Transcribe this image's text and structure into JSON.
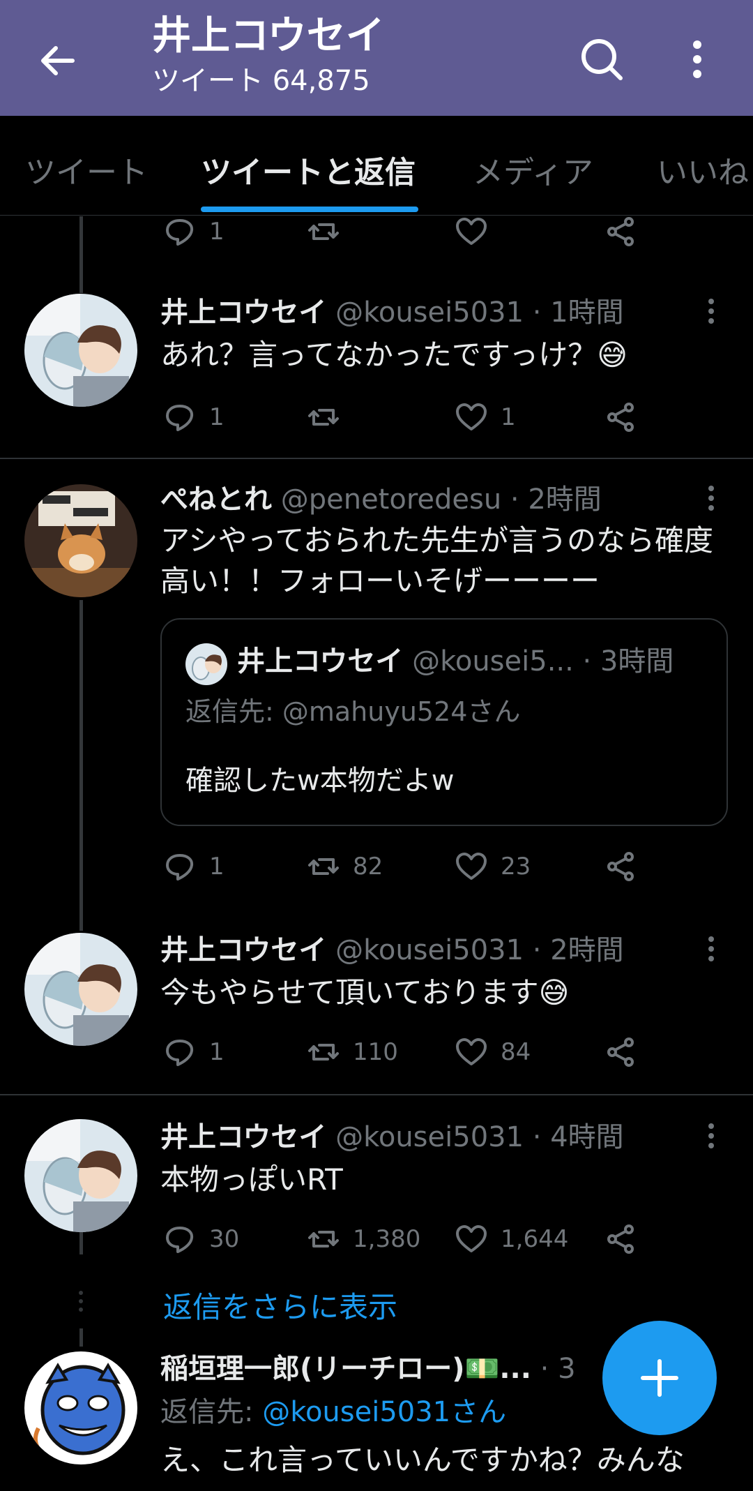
{
  "header": {
    "title": "井上コウセイ",
    "subtitle": "ツイート 64,875"
  },
  "tabs": [
    {
      "label": "ツイート",
      "active": false
    },
    {
      "label": "ツイートと返信",
      "active": true
    },
    {
      "label": "メディア",
      "active": false
    },
    {
      "label": "いいね",
      "active": false
    }
  ],
  "top_partial": {
    "replies": "1"
  },
  "tweets": [
    {
      "name": "井上コウセイ",
      "meta": " @kousei5031 · 1時間",
      "text": "あれ？言ってなかったですっけ？😅",
      "replies": "1",
      "retweets": "",
      "likes": "1"
    },
    {
      "name": "ぺねとれ",
      "meta": " @penetoredesu · 2時間",
      "text": "アシやっておられた先生が言うのなら確度高い！！フォローいそげーーーー",
      "quote": {
        "name": "井上コウセイ",
        "meta": " @kousei5...  · 3時間",
        "reply_to": "返信先: @mahuyu524さん",
        "text": "確認したw本物だよw"
      },
      "replies": "1",
      "retweets": "82",
      "likes": "23"
    },
    {
      "name": "井上コウセイ",
      "meta": " @kousei5031 · 2時間",
      "text": "今もやらせて頂いております😅",
      "replies": "1",
      "retweets": "110",
      "likes": "84"
    },
    {
      "name": "井上コウセイ",
      "meta": " @kousei5031 · 4時間",
      "text": "本物っぽいRT",
      "replies": "30",
      "retweets": "1,380",
      "likes": "1,644"
    }
  ],
  "show_more_replies": "返信をさらに表示",
  "last_tweet": {
    "name": "稲垣理一郎(リーチロー)💵...",
    "meta": " · 3",
    "reply_prefix": "返信先: ",
    "reply_handle": "@kousei5031さん",
    "text": "え、これ言っていいんですかね？みんな"
  },
  "colors": {
    "header_bg": "#5f5b93",
    "accent": "#1d9bf0",
    "muted": "#71767b",
    "background": "#000000"
  }
}
